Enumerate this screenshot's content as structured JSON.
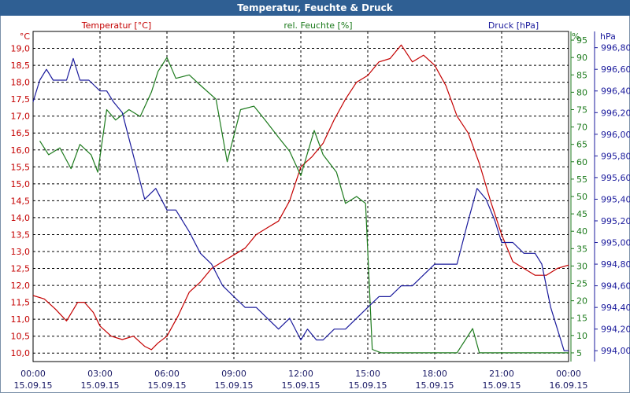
{
  "window": {
    "title": "Temperatur, Feuchte & Druck"
  },
  "chart_data": {
    "type": "line",
    "title": "Temperatur, Feuchte & Druck",
    "x_axis": {
      "ticks": [
        {
          "time": "00:00",
          "date": "15.09.15"
        },
        {
          "time": "03:00",
          "date": "15.09.15"
        },
        {
          "time": "06:00",
          "date": "15.09.15"
        },
        {
          "time": "09:00",
          "date": "15.09.15"
        },
        {
          "time": "12:00",
          "date": "15.09.15"
        },
        {
          "time": "15:00",
          "date": "15.09.15"
        },
        {
          "time": "18:00",
          "date": "15.09.15"
        },
        {
          "time": "21:00",
          "date": "15.09.15"
        },
        {
          "time": "00:00",
          "date": "16.09.15"
        }
      ],
      "range_hours": [
        0,
        24
      ]
    },
    "axes": {
      "temperature": {
        "label": "Temperatur [°C]",
        "unit": "°C",
        "min": 9.75,
        "max": 19.5,
        "ticks": [
          "10,0",
          "10,5",
          "11,0",
          "11,5",
          "12,0",
          "12,5",
          "13,0",
          "13,5",
          "14,0",
          "14,5",
          "15,0",
          "15,5",
          "16,0",
          "16,5",
          "17,0",
          "17,5",
          "18,0",
          "18,5",
          "19,0"
        ],
        "color": "#c40000"
      },
      "humidity": {
        "label": "rel. Feuchte [%]",
        "unit": "%",
        "min": 2.5,
        "max": 97.5,
        "ticks": [
          "5",
          "10",
          "15",
          "20",
          "25",
          "30",
          "35",
          "40",
          "45",
          "50",
          "55",
          "60",
          "65",
          "70",
          "75",
          "80",
          "85",
          "90",
          "95"
        ],
        "color": "#1c7a1c"
      },
      "pressure": {
        "label": "Druck [hPa]",
        "unit": "hPa",
        "min": 993.9,
        "max": 996.95,
        "ticks": [
          "994,00",
          "994,20",
          "994,40",
          "994,60",
          "994,80",
          "995,00",
          "995,20",
          "995,40",
          "995,60",
          "995,80",
          "996,00",
          "996,20",
          "996,40",
          "996,60",
          "996,80"
        ],
        "color": "#1a1a9c"
      }
    },
    "grid": true,
    "series": [
      {
        "name": "Temperatur",
        "axis": "temperature",
        "color": "#c40000",
        "x": [
          0,
          0.5,
          1,
          1.5,
          2,
          2.3,
          2.7,
          3,
          3.5,
          4,
          4.5,
          5,
          5.3,
          5.6,
          6,
          6.5,
          7,
          7.5,
          8,
          8.5,
          9,
          9.5,
          10,
          10.5,
          11,
          11.5,
          12,
          12.5,
          13,
          13.5,
          14,
          14.5,
          15,
          15.5,
          16,
          16.5,
          17,
          17.5,
          18,
          18.5,
          19,
          19.5,
          20,
          20.5,
          21,
          21.5,
          22,
          22.5,
          23,
          23.5,
          24
        ],
        "y": [
          11.7,
          11.6,
          11.3,
          10.95,
          11.5,
          11.5,
          11.2,
          10.8,
          10.5,
          10.4,
          10.5,
          10.2,
          10.1,
          10.3,
          10.5,
          11.1,
          11.8,
          12.1,
          12.5,
          12.7,
          12.9,
          13.1,
          13.5,
          13.7,
          13.9,
          14.5,
          15.5,
          15.8,
          16.2,
          16.9,
          17.5,
          18.0,
          18.2,
          18.6,
          18.7,
          19.1,
          18.6,
          18.8,
          18.5,
          17.9,
          17.0,
          16.5,
          15.6,
          14.5,
          13.5,
          12.7,
          12.5,
          12.3,
          12.3,
          12.5,
          12.6
        ]
      },
      {
        "name": "rel. Feuchte",
        "axis": "humidity",
        "color": "#1c7a1c",
        "x": [
          0.3,
          0.7,
          1.2,
          1.7,
          2.1,
          2.6,
          2.9,
          3.3,
          3.7,
          4.3,
          4.8,
          5.3,
          5.6,
          6,
          6.4,
          7,
          7.5,
          8.2,
          8.7,
          9.3,
          9.9,
          10.4,
          11,
          11.5,
          12,
          12.6,
          13,
          13.6,
          14,
          14.5,
          14.9,
          15.2,
          15.6,
          16,
          17,
          18,
          19,
          19.7,
          20,
          21,
          22,
          23,
          24
        ],
        "y": [
          66,
          62,
          64,
          58,
          65,
          62,
          57,
          75,
          72,
          75,
          73,
          80,
          86,
          90,
          84,
          85,
          82,
          78,
          60,
          75,
          76,
          72,
          67,
          63,
          56,
          69,
          62,
          57,
          48,
          50,
          48,
          6,
          5,
          5,
          5,
          5,
          5,
          12,
          5,
          5,
          5,
          5,
          5
        ]
      },
      {
        "name": "Druck",
        "axis": "pressure",
        "color": "#1a1a9c",
        "x": [
          0,
          0.3,
          0.6,
          0.9,
          1.5,
          1.8,
          2.1,
          2.5,
          3,
          3.3,
          3.6,
          4,
          4.5,
          5,
          5.5,
          6,
          6.4,
          7,
          7.5,
          8,
          8.5,
          9,
          9.5,
          10,
          10.5,
          11,
          11.5,
          12,
          12.3,
          12.7,
          13,
          13.5,
          14,
          14.5,
          15,
          15.5,
          16,
          16.5,
          17,
          17.5,
          18,
          18.5,
          19,
          19.5,
          19.9,
          20.3,
          20.7,
          21,
          21.5,
          22,
          22.5,
          22.8,
          23.2,
          23.5,
          23.8,
          24
        ],
        "y": [
          996.3,
          996.5,
          996.6,
          996.5,
          996.5,
          996.7,
          996.5,
          996.5,
          996.4,
          996.4,
          996.3,
          996.2,
          995.8,
          995.4,
          995.5,
          995.3,
          995.3,
          995.1,
          994.9,
          994.8,
          994.6,
          994.5,
          994.4,
          994.4,
          994.3,
          994.2,
          994.3,
          994.1,
          994.2,
          994.1,
          994.1,
          994.2,
          994.2,
          994.3,
          994.4,
          994.5,
          994.5,
          994.6,
          994.6,
          994.7,
          994.8,
          994.8,
          994.8,
          995.2,
          995.5,
          995.4,
          995.2,
          995.0,
          995.0,
          994.9,
          994.9,
          994.8,
          994.4,
          994.2,
          994.0,
          994.0
        ]
      }
    ]
  }
}
